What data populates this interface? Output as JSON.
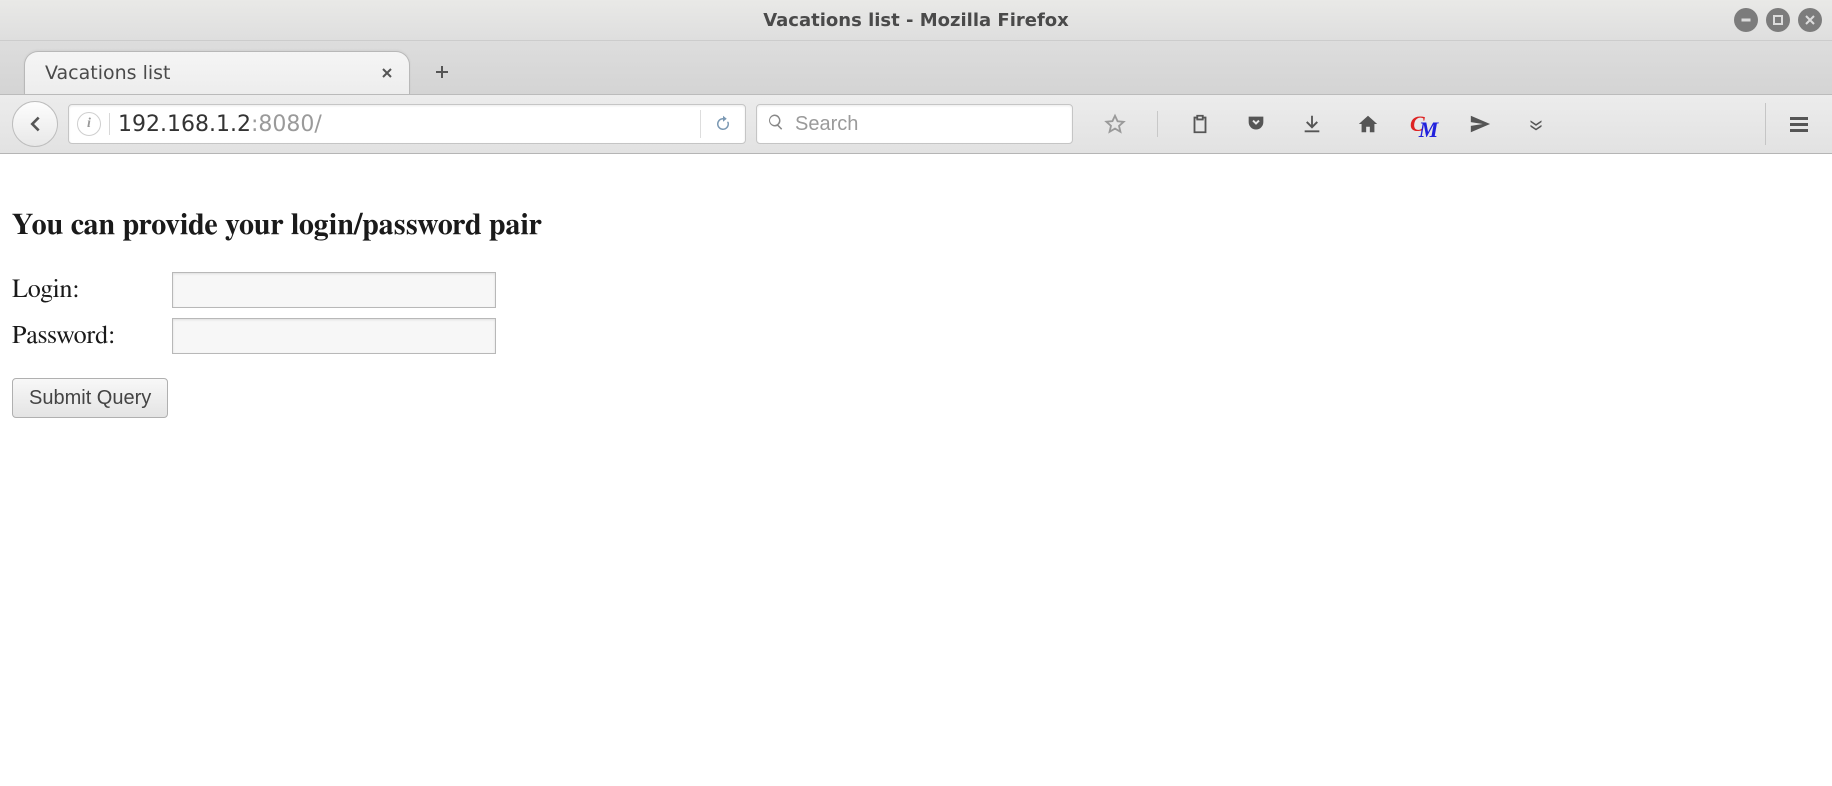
{
  "window": {
    "title": "Vacations list - Mozilla Firefox"
  },
  "tabs": [
    {
      "label": "Vacations list"
    }
  ],
  "url": {
    "host": "192.168.1.2",
    "port_path": ":8080/"
  },
  "search": {
    "placeholder": "Search",
    "value": ""
  },
  "page": {
    "heading": "You can provide your login/password pair",
    "login_label": "Login:",
    "password_label": "Password:",
    "login_value": "",
    "password_value": "",
    "submit_label": "Submit Query"
  }
}
